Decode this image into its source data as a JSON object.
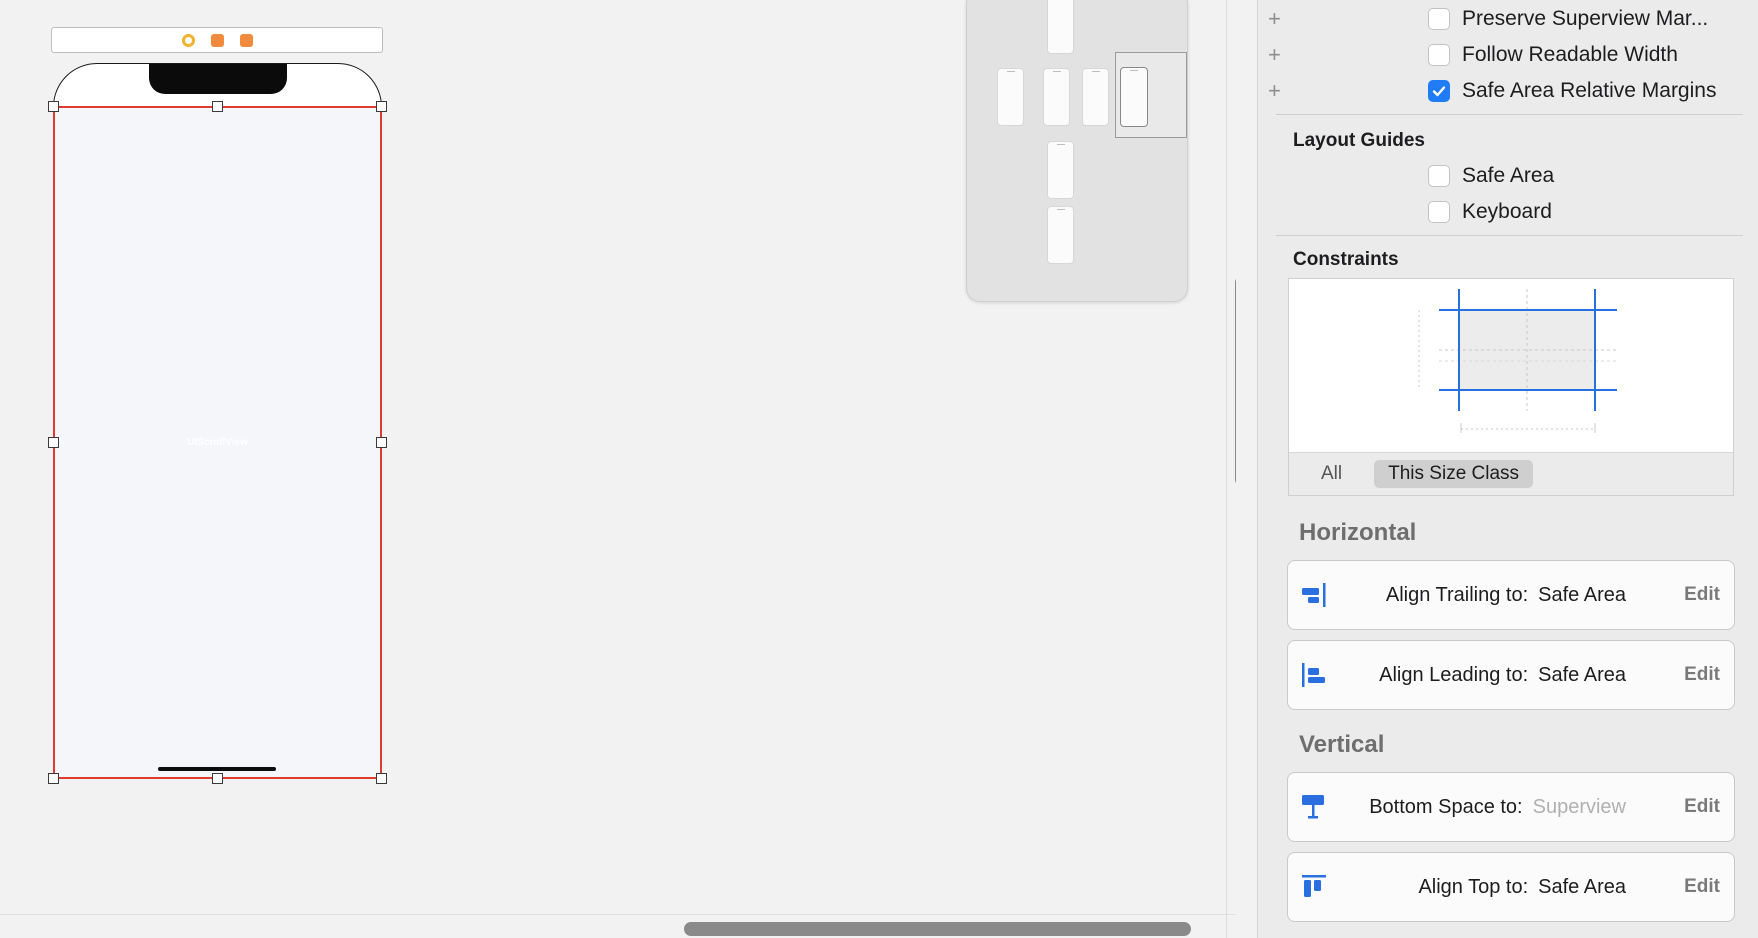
{
  "canvas": {
    "scroll_view_label": "UIScrollView"
  },
  "inspector": {
    "margins": [
      {
        "label": "Preserve Superview Mar...",
        "checked": false
      },
      {
        "label": "Follow Readable Width",
        "checked": false
      },
      {
        "label": "Safe Area Relative Margins",
        "checked": true
      }
    ],
    "layout_guides_title": "Layout Guides",
    "layout_guides": [
      {
        "label": "Safe Area",
        "checked": false
      },
      {
        "label": "Keyboard",
        "checked": false
      }
    ],
    "constraints_title": "Constraints",
    "segments": [
      "All",
      "This Size Class"
    ],
    "horizontal_title": "Horizontal",
    "vertical_title": "Vertical",
    "edit_label": "Edit",
    "horizontal": [
      {
        "icon": "align-trailing-icon",
        "label": "Align Trailing to:",
        "target": "Safe Area",
        "dim": false
      },
      {
        "icon": "align-leading-icon",
        "label": "Align Leading to:",
        "target": "Safe Area",
        "dim": false
      }
    ],
    "vertical": [
      {
        "icon": "bottom-space-icon",
        "label": "Bottom Space to:",
        "target": "Superview",
        "dim": true
      },
      {
        "icon": "align-top-icon",
        "label": "Align Top to:",
        "target": "Safe Area",
        "dim": false
      }
    ]
  },
  "colors": {
    "accent": "#1f7cf4",
    "selection": "#e03b32"
  }
}
